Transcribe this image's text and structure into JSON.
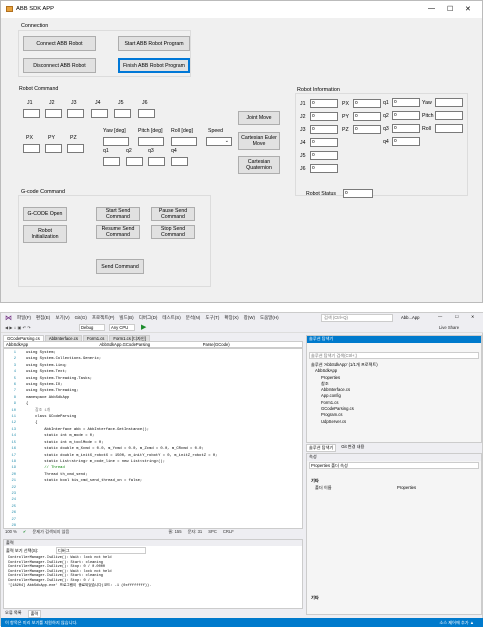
{
  "app": {
    "title": "ABB SDK APP",
    "min": "—",
    "max": "☐",
    "close": "✕"
  },
  "connection": {
    "title": "Connection",
    "connect": "Connect ABB Robot",
    "disconnect": "Disconnect ABB Robot",
    "start": "Start ABB Robot Program",
    "finish": "Finish ABB Robot Program"
  },
  "robot_command": {
    "title": "Robot Command",
    "joint_labels": [
      "J1",
      "J2",
      "J3",
      "J4",
      "J5",
      "J6"
    ],
    "pos_labels": [
      "PX",
      "PY",
      "PZ"
    ],
    "yaw": "Yaw [deg]",
    "pitch": "Pitch [deg]",
    "roll": "Roll [deg]",
    "speed": "Speed",
    "q_labels": [
      "q1",
      "q2",
      "q3",
      "q4"
    ],
    "joint_move": "Joint Move",
    "cartesian_euler": "Cartesian Euler\nMove",
    "cartesian_quat": "Cartesian\nQuaternion"
  },
  "robot_info": {
    "title": "Robot Information",
    "j_labels": [
      "J1",
      "J2",
      "J3",
      "J4",
      "J5",
      "J6"
    ],
    "j_values": [
      "0",
      "0",
      "0",
      "0",
      "0",
      "0"
    ],
    "p_labels": [
      "PX",
      "PY",
      "PZ"
    ],
    "p_values": [
      "0",
      "0",
      "0"
    ],
    "q_labels": [
      "q1",
      "q2",
      "q3",
      "q4"
    ],
    "q_values": [
      "0",
      "0",
      "0",
      "0"
    ],
    "e_labels": [
      "Yaw",
      "Pitch",
      "Roll"
    ],
    "status_label": "Robot Status",
    "status_value": "0"
  },
  "gcode": {
    "title": "G-code Command",
    "open": "G-CODE Open",
    "init": "Robot\nInitialization",
    "start": "Start Send\nCommand",
    "resume": "Resume Send\nCommand",
    "pause": "Pause Send\nCommand",
    "stop": "Stop Send\nCommand",
    "send": "Send Command"
  },
  "vs": {
    "menu": [
      "파일(F)",
      "편집(E)",
      "보기(V)",
      "Git(G)",
      "프로젝트(P)",
      "빌드(B)",
      "디버그(D)",
      "테스트(S)",
      "분석(N)",
      "도구(T)",
      "확장(X)",
      "창(W)",
      "도움말(H)"
    ],
    "search": "검색 (Ctrl+Q)",
    "solution_name": "Abb...App",
    "live_share": "Live Share",
    "config": "Debug",
    "platform": "Any CPU",
    "tabs": [
      "GCodeParsing.cs",
      "AbbInterface.cs",
      "Form1.cs",
      "Form1.cs [디자인]"
    ],
    "nav1": "AbbSdkApp",
    "nav2": "AbbSdkApp.GCodeParsing",
    "nav3": "Parse(GCode)",
    "code": [
      "using System;",
      "using System.Collections.Generic;",
      "using System.Linq;",
      "using System.Text;",
      "using System.Threading.Tasks;",
      "using System.IO;",
      "using System.Threading;",
      "",
      "namespace AbbSdkApp",
      "{",
      "    참조 1개",
      "    class GCodeParsing",
      "    {",
      "        AbbInterface abb = AbbInterface.GetInstance();",
      "",
      "        static int m_mode = 0;",
      "        static int m_toolMode = 0;",
      "",
      "        static double m_Xcmd = 0.0, m_Ycmd = 0.0, m_Zcmd = 0.0, m_CRcmd = 0.0;",
      "",
      "        static double m_initX_robotX = 1500, m_initY_robotY = 0, m_initZ_robotZ = 0;",
      "",
      "        static List<string> m_code_line = new List<string>();",
      "",
      "",
      "        // Thread",
      "        Thread th_cmd_send;",
      "        static bool bis_cmd_send_thread_on = false;"
    ],
    "zoom": "100 %",
    "issues": "문제가 검색되지 않음",
    "ln": "줄: 155",
    "ch": "문자: 31",
    "spc": "SPC",
    "crlf": "CRLF",
    "output_title": "출력",
    "output_source_label": "출력 보기 선택(S):",
    "output_source": "디버그",
    "output_lines": [
      "ControllerManager.IsAlive(): Wait: lock not held",
      "ControllerManager.IsAlive(): Start: cleaning",
      "ControllerManager.IsAlive(): Stop: 0 / 0.0000",
      "ControllerManager.IsAlive(): Wait: lock not held",
      "ControllerManager.IsAlive(): Start: cleaning",
      "ControllerManager.IsAlive(): Stop: 0 / 1",
      "'[18204] AbbSdkApp.exe' 프로그램이 종료되었습니다(코드: -1 (0xffffffff))."
    ],
    "bottom_tabs": [
      "오류 목록",
      "출력"
    ],
    "status_left": "이 항목은 미리 보기를 지원하지 않습니다.",
    "status_right": "소스 제어에 추가 ▲",
    "sol_title": "솔루션 탐색기",
    "sol_search": "솔루션 탐색기 검색(Ctrl+;)",
    "sol_items": [
      "솔루션 'AbbSdkApp' (1/1개 프로젝트)",
      "AbbSdkApp",
      "Properties",
      "참조",
      "AbbInterface.cs",
      "App.config",
      "Form1.cs",
      "GCodeParsing.cs",
      "Program.cs",
      "UdpServer.cs"
    ],
    "sol_tabs": [
      "솔루션 탐색기",
      "Git 변경 내용"
    ],
    "prop_title": "속성",
    "prop_sub": "Properties 폴더 속성",
    "prop_cat": "기타",
    "prop_key": "폴더 이름",
    "prop_val": "Properties",
    "prop_desc": "기타"
  }
}
